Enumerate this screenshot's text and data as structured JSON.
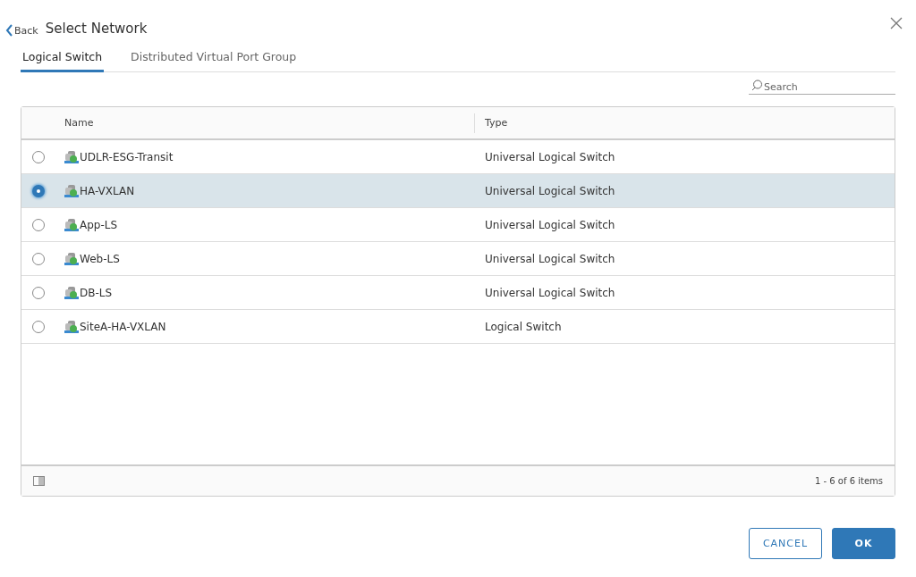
{
  "header": {
    "back": "Back",
    "title": "Select Network"
  },
  "tabs": [
    {
      "label": "Logical Switch",
      "selected": true
    },
    {
      "label": "Distributed Virtual Port Group",
      "selected": false
    }
  ],
  "search": {
    "placeholder": "Search"
  },
  "table": {
    "columns": [
      "Name",
      "Type"
    ],
    "rows": [
      {
        "name": "UDLR-ESG-Transit",
        "type": "Universal Logical Switch",
        "selected": false
      },
      {
        "name": "HA-VXLAN",
        "type": "Universal Logical Switch",
        "selected": true
      },
      {
        "name": "App-LS",
        "type": "Universal Logical Switch",
        "selected": false
      },
      {
        "name": "Web-LS",
        "type": "Universal Logical Switch",
        "selected": false
      },
      {
        "name": "DB-LS",
        "type": "Universal Logical Switch",
        "selected": false
      },
      {
        "name": "SiteA-HA-VXLAN",
        "type": "Logical Switch",
        "selected": false
      }
    ],
    "footer": "1 - 6 of 6 items"
  },
  "buttons": [
    {
      "label": "CANCEL",
      "kind": "secondary"
    },
    {
      "label": "OK",
      "kind": "primary"
    }
  ]
}
